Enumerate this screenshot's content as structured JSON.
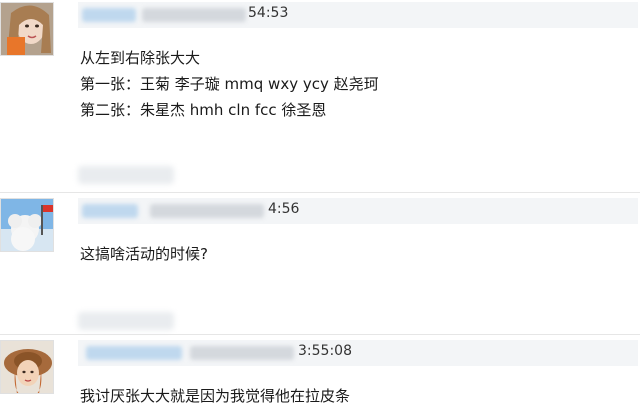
{
  "comments": [
    {
      "avatar_icon": "user-avatar-girl-icon",
      "time": "54:53",
      "lines": [
        "从左到右除张大大",
        "第一张：王菊 李子璇 mmq wxy ycy 赵尧珂",
        "第二张：朱星杰 hmh cln fcc 徐圣恩"
      ]
    },
    {
      "avatar_icon": "user-avatar-white-dog-icon",
      "time": "4:56",
      "lines": [
        "这搞啥活动的时候?"
      ]
    },
    {
      "avatar_icon": "user-avatar-woman-hat-icon",
      "time": "3:55:08",
      "lines": [
        "我讨厌张大大就是因为我觉得他在拉皮条"
      ]
    }
  ]
}
